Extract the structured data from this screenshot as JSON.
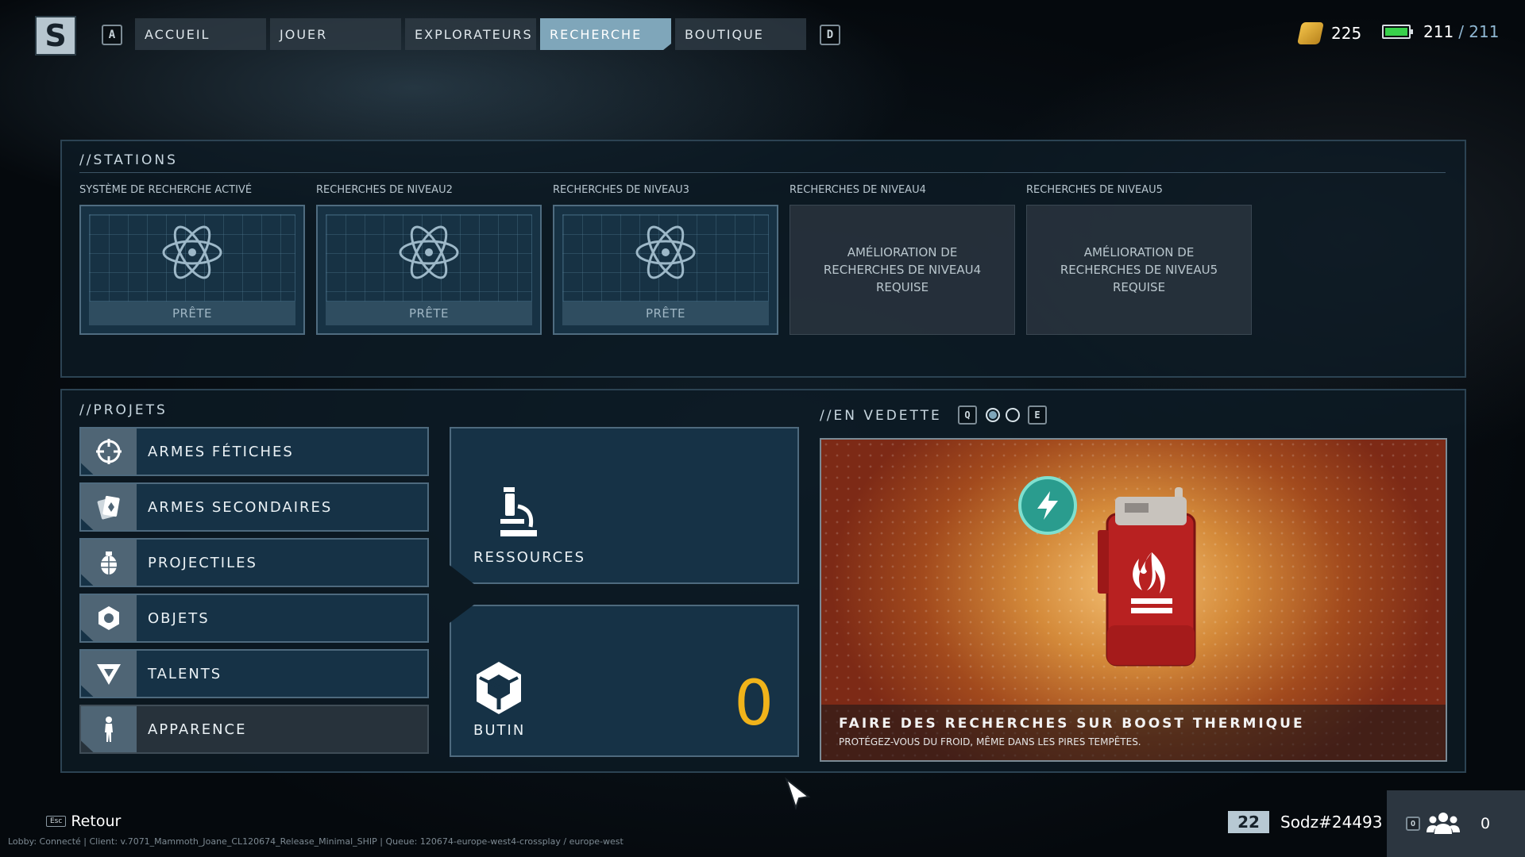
{
  "logo": {
    "letter": "S"
  },
  "nav": {
    "key_left": "A",
    "key_right": "D",
    "tabs": [
      {
        "label": "ACCUEIL"
      },
      {
        "label": "JOUER"
      },
      {
        "label": "EXPLORATEURS"
      },
      {
        "label": "RECHERCHE",
        "active": true
      },
      {
        "label": "BOUTIQUE"
      }
    ]
  },
  "currency": {
    "coins": "225",
    "energy": "211",
    "energy_max": "/ 211"
  },
  "stations": {
    "title": "//STATIONS",
    "items": [
      {
        "label": "SYSTÈME DE RECHERCHE ACTIVÉ",
        "status": "PRÊTE"
      },
      {
        "label": "RECHERCHES DE NIVEAU2",
        "status": "PRÊTE"
      },
      {
        "label": "RECHERCHES DE NIVEAU3",
        "status": "PRÊTE"
      },
      {
        "label": "RECHERCHES DE NIVEAU4",
        "locked_text": "AMÉLIORATION DE RECHERCHES DE NIVEAU4 REQUISE"
      },
      {
        "label": "RECHERCHES DE NIVEAU5",
        "locked_text": "AMÉLIORATION DE RECHERCHES DE NIVEAU5 REQUISE"
      }
    ]
  },
  "projects": {
    "title": "//PROJETS",
    "items": [
      {
        "label": "ARMES FÉTICHES",
        "icon": "crosshair-icon"
      },
      {
        "label": "ARMES SECONDAIRES",
        "icon": "cards-icon"
      },
      {
        "label": "PROJECTILES",
        "icon": "grenade-icon"
      },
      {
        "label": "OBJETS",
        "icon": "hexagon-icon"
      },
      {
        "label": "TALENTS",
        "icon": "triangle-icon"
      },
      {
        "label": "APPARENCE",
        "icon": "figure-icon"
      }
    ],
    "resources_label": "RESSOURCES",
    "loot_label": "BUTIN",
    "loot_count": "0"
  },
  "featured": {
    "title": "//EN VEDETTE",
    "key_left": "Q",
    "key_right": "E",
    "item_title": "FAIRE DES RECHERCHES SUR BOOST THERMIQUE",
    "item_subtitle": "PROTÉGEZ-VOUS DU FROID, MÊME DANS LES PIRES TEMPÊTES."
  },
  "footer": {
    "esc_key": "Esc",
    "back_label": "Retour",
    "lobby_info": "Lobby: Connecté | Client: v.7071_Mammoth_Joane_CL120674_Release_Minimal_SHIP | Queue: 120674-europe-west4-crossplay / europe-west",
    "player_level": "22",
    "player_name": "Sodz#24493",
    "party_key": "O",
    "party_count": "0"
  },
  "colors": {
    "accent": "#7fa6ba",
    "coin": "#e8b33b",
    "loot_count": "#f0b31a",
    "energy": "#38d14b"
  }
}
